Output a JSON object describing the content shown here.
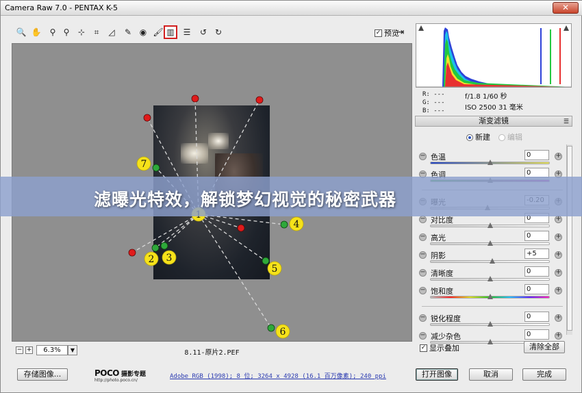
{
  "window": {
    "title": "Camera Raw 7.0 -  PENTAX K-5",
    "close_glyph": "✕"
  },
  "toolbar": {
    "tools": [
      {
        "name": "zoom-tool",
        "glyph": "🔍"
      },
      {
        "name": "hand-tool",
        "glyph": "✋"
      },
      {
        "name": "white-balance-tool",
        "glyph": "⚲"
      },
      {
        "name": "color-sampler-tool",
        "glyph": "⚲"
      },
      {
        "name": "targeted-adjustment-tool",
        "glyph": "⊹"
      },
      {
        "name": "crop-tool",
        "glyph": "⌗"
      },
      {
        "name": "straighten-tool",
        "glyph": "◿"
      },
      {
        "name": "spot-removal-tool",
        "glyph": "✎"
      },
      {
        "name": "red-eye-tool",
        "glyph": "◉"
      },
      {
        "name": "adjustment-brush-tool",
        "glyph": "🖌"
      },
      {
        "name": "graduated-filter-tool",
        "glyph": "▥"
      },
      {
        "name": "preferences-tool",
        "glyph": "☰"
      },
      {
        "name": "rotate-ccw-tool",
        "glyph": "↺"
      },
      {
        "name": "rotate-cw-tool",
        "glyph": "↻"
      }
    ],
    "preview_label": "预览",
    "preview_checked": "✓",
    "fullscreen_glyph": "⇥"
  },
  "canvas": {
    "markers": [
      {
        "num": "1"
      },
      {
        "num": "2"
      },
      {
        "num": "3"
      },
      {
        "num": "4"
      },
      {
        "num": "5"
      },
      {
        "num": "6"
      },
      {
        "num": "7"
      }
    ]
  },
  "status": {
    "zoom_minus": "−",
    "zoom_plus": "+",
    "zoom_value": "6.3%",
    "zoom_dropdown": "▼",
    "file_name": "8.11-原片2.PEF"
  },
  "readout": {
    "r": "R:  ---",
    "g": "G:  ---",
    "b": "B:  ---",
    "exif_line1": "f/1.8   1/60 秒",
    "exif_line2": "ISO 2500   31 毫米"
  },
  "panel": {
    "title": "渐变滤镜",
    "menu_glyph": "☰",
    "mode_new": "新建",
    "mode_edit": "编辑",
    "sliders": [
      {
        "label": "色温",
        "value": "0",
        "pos": 0.5,
        "track": "temp"
      },
      {
        "label": "色调",
        "value": "0",
        "pos": 0.5,
        "track": "tint"
      },
      {
        "label": "曝光",
        "value": "-0.20",
        "pos": 0.48,
        "track": "plain"
      },
      {
        "label": "对比度",
        "value": "0",
        "pos": 0.5,
        "track": "plain"
      },
      {
        "label": "高光",
        "value": "0",
        "pos": 0.5,
        "track": "plain"
      },
      {
        "label": "阴影",
        "value": "+5",
        "pos": 0.52,
        "track": "plain"
      },
      {
        "label": "清晰度",
        "value": "0",
        "pos": 0.5,
        "track": "plain"
      },
      {
        "label": "饱和度",
        "value": "0",
        "pos": 0.5,
        "track": "sat"
      },
      {
        "label": "锐化程度",
        "value": "0",
        "pos": 0.5,
        "track": "plain"
      },
      {
        "label": "减少杂色",
        "value": "0",
        "pos": 0.5,
        "track": "plain"
      }
    ],
    "overlay_label": "显示叠加",
    "overlay_checked": "✓",
    "clear_label": "清除全部"
  },
  "footer": {
    "save_label": "存储图像...",
    "logo_brand": "POCO",
    "logo_brand_cn": "摄影专题",
    "logo_url": "http://photo.poco.cn/",
    "workflow": "Adobe RGB (1998); 8 位; 3264 x 4928 (16.1 百万像素); 240 ppi",
    "open_label": "打开图像",
    "cancel_label": "取消",
    "done_label": "完成"
  },
  "banner": {
    "text": "滤曝光特效，解锁梦幻视觉的秘密武器"
  },
  "colors": {
    "banner_bg": "#8ca0cd",
    "marker_yellow": "#f6e21a",
    "pin_red": "#e01b1b",
    "pin_green": "#2ea83a",
    "active_tool_border": "#d21f1f"
  }
}
